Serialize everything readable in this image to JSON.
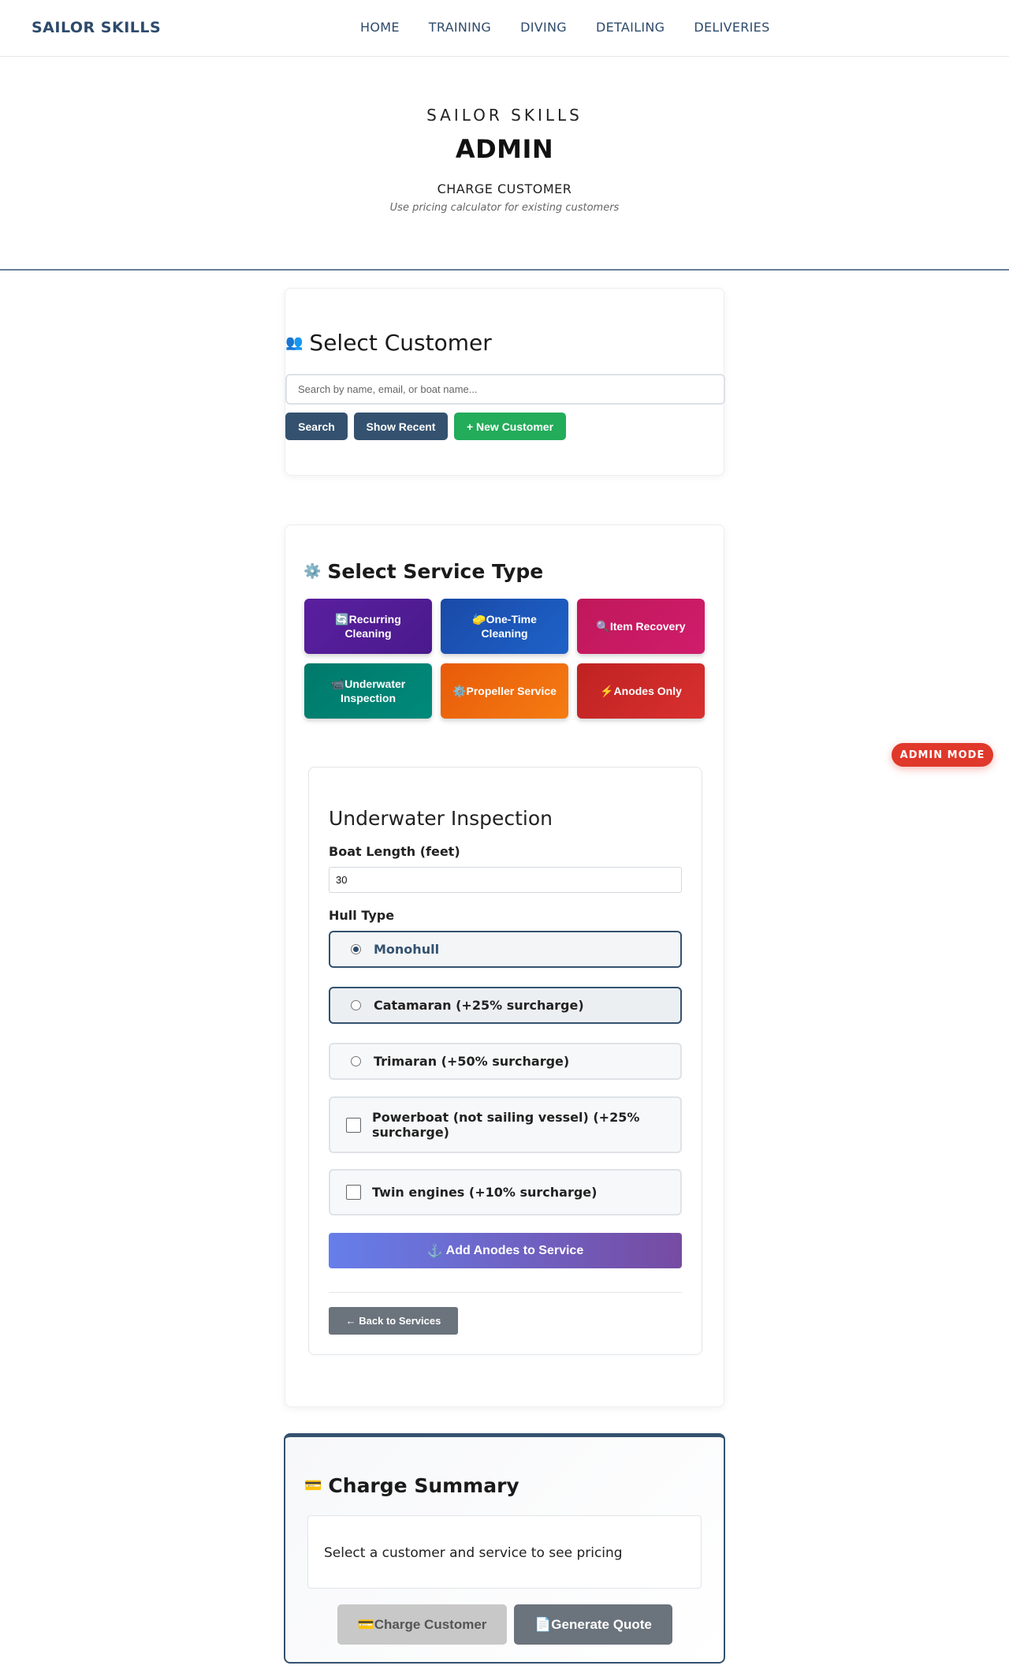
{
  "nav": {
    "brand": "SAILOR SKILLS",
    "links": [
      "HOME",
      "TRAINING",
      "DIVING",
      "DETAILING",
      "DELIVERIES"
    ]
  },
  "hero": {
    "kicker": "SAILOR SKILLS",
    "title": "ADMIN",
    "subtitle": "CHARGE CUSTOMER",
    "description": "Use pricing calculator for existing customers"
  },
  "customer": {
    "icon": "👥",
    "title": "Select Customer",
    "search_placeholder": "Search by name, email, or boat name...",
    "search_label": "Search",
    "recent_label": "Show Recent",
    "new_label": "+ New Customer"
  },
  "service": {
    "icon": "⚙️",
    "title": "Select Service Type",
    "options": [
      {
        "icon": "🔄",
        "label": "Recurring Cleaning"
      },
      {
        "icon": "🧽",
        "label": "One-Time Cleaning"
      },
      {
        "icon": "🔍",
        "label": "Item Recovery"
      },
      {
        "icon": "📹",
        "label": "Underwater Inspection"
      },
      {
        "icon": "⚙️",
        "label": "Propeller Service"
      },
      {
        "icon": "⚡",
        "label": "Anodes Only"
      }
    ]
  },
  "form": {
    "title": "Underwater Inspection",
    "boat_length_label": "Boat Length (feet)",
    "boat_length_value": "30",
    "hull_type_label": "Hull Type",
    "hull_options": [
      {
        "label": "Monohull",
        "selected": true
      },
      {
        "label": "Catamaran (+25% surcharge)",
        "selected": false
      },
      {
        "label": "Trimaran (+50% surcharge)",
        "selected": false
      }
    ],
    "powerboat_label": "Powerboat (not sailing vessel) (+25% surcharge)",
    "twin_engines_label": "Twin engines (+10% surcharge)",
    "add_anodes_icon": "⚓",
    "add_anodes_label": "Add Anodes to Service",
    "back_label": "← Back to Services"
  },
  "summary": {
    "icon": "💳",
    "title": "Charge Summary",
    "placeholder_text": "Select a customer and service to see pricing",
    "charge_label": "💳Charge Customer",
    "quote_label": "📄Generate Quote"
  },
  "admin_badge": "ADMIN MODE",
  "colors": {
    "brand": "#2d4a6b",
    "primary_button": "#34526f",
    "new_customer": "#23ac5a",
    "admin_badge": "#e0382b"
  }
}
